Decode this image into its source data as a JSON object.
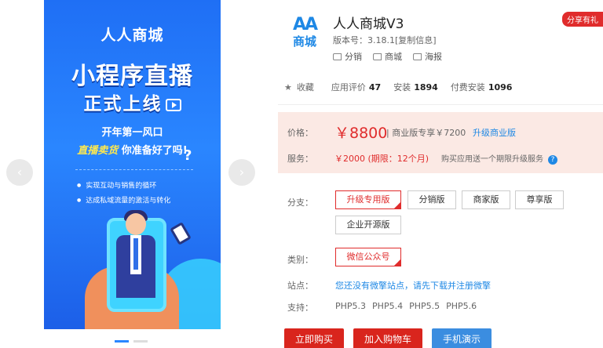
{
  "banner": {
    "brand": "人人商城",
    "headline": "小程序直播",
    "subhead": "正式上线",
    "tagline1": "开年第一风口",
    "tagline2_em": "直播卖货",
    "tagline2_rest": "你准备好了吗!",
    "bullets": [
      "实现互动与销售的循环",
      "达成私域流量的激活与转化"
    ]
  },
  "app": {
    "logo_top": "AA",
    "logo_bottom": "商城",
    "title": "人人商城V3",
    "version": "版本号：3.18.1[复制信息]",
    "tags": [
      "分销",
      "商城",
      "海报"
    ],
    "share": "分享有礼"
  },
  "stats": {
    "favorite": "收藏",
    "rating_label": "应用评价",
    "rating": "47",
    "install_label": "安装",
    "installs": "1894",
    "paid_label": "付费安装",
    "paid": "1096"
  },
  "price": {
    "label": "价格：",
    "main": "￥8800",
    "sub": "| 商业版专享￥7200",
    "upgrade": "升级商业版",
    "service_label": "服务：",
    "service_val": "￥2000 (期限：12个月)",
    "service_note": "购买应用送一个期限升级服务"
  },
  "edition": {
    "label": "分支：",
    "options": [
      "升级专用版",
      "分销版",
      "商家版",
      "尊享版",
      "企业开源版"
    ],
    "selected": "升级专用版"
  },
  "category": {
    "label": "类别：",
    "value": "微信公众号"
  },
  "site": {
    "label": "站点：",
    "message": "您还没有微擎站点，请先下载并注册微擎"
  },
  "support": {
    "label": "支持：",
    "versions": [
      "PHP5.3",
      "PHP5.4",
      "PHP5.5",
      "PHP5.6"
    ]
  },
  "actions": {
    "buy": "立即购买",
    "cart": "加入购物车",
    "demo": "手机演示"
  },
  "colors": {
    "accent_red": "#e02c2c",
    "accent_blue": "#1e88e5",
    "banner_blue": "#2a86ff"
  }
}
